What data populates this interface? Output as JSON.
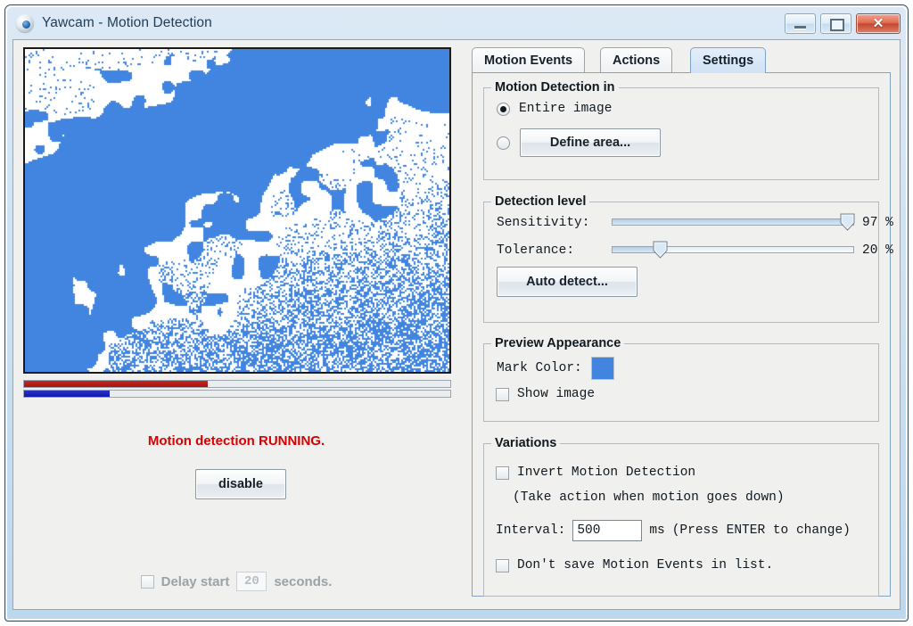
{
  "window": {
    "title": "Yawcam - Motion Detection",
    "icon": "webcam-icon",
    "minimize_label": "",
    "maximize_label": "",
    "close_label": "✕"
  },
  "preview": {
    "mark_color": "#4285e0",
    "background_color": "#ffffff",
    "bars": [
      {
        "name": "red-level-bar",
        "color": "#b81a14",
        "percent": 43
      },
      {
        "name": "blue-level-bar",
        "color": "#1c22bd",
        "percent": 20
      }
    ]
  },
  "left": {
    "status": "Motion detection RUNNING.",
    "status_color": "#d80000",
    "toggle_button": "disable",
    "delay": {
      "checked": false,
      "label_before": "Delay start",
      "value": "20",
      "label_after": "seconds.",
      "enabled": false
    }
  },
  "tabs": [
    {
      "label": "Motion Events",
      "active": false
    },
    {
      "label": "Actions",
      "active": false
    },
    {
      "label": "Settings",
      "active": true
    }
  ],
  "settings": {
    "motion_detection_in": {
      "title": "Motion Detection in",
      "options": [
        {
          "label": "Entire image",
          "selected": true
        },
        {
          "label": "Define area...",
          "selected": false,
          "is_button": true
        }
      ]
    },
    "detection_level": {
      "title": "Detection level",
      "sensitivity": {
        "label": "Sensitivity:",
        "value": 97,
        "unit": "%",
        "value_text": "97 %"
      },
      "tolerance": {
        "label": "Tolerance:",
        "value": 20,
        "unit": "%",
        "value_text": "20 %"
      },
      "auto_detect_button": "Auto detect..."
    },
    "preview_appearance": {
      "title": "Preview Appearance",
      "mark_color_label": "Mark Color:",
      "mark_color": "#4285e0",
      "show_image": {
        "label": "Show image",
        "checked": false
      }
    },
    "variations": {
      "title": "Variations",
      "invert": {
        "label": "Invert Motion Detection",
        "checked": false
      },
      "invert_note": "(Take action when motion goes down)",
      "interval": {
        "label": "Interval:",
        "value": "500",
        "unit": "ms",
        "hint": "(Press ENTER to change)"
      },
      "dont_save": {
        "label": "Don't save Motion Events in list.",
        "checked": false
      }
    }
  }
}
